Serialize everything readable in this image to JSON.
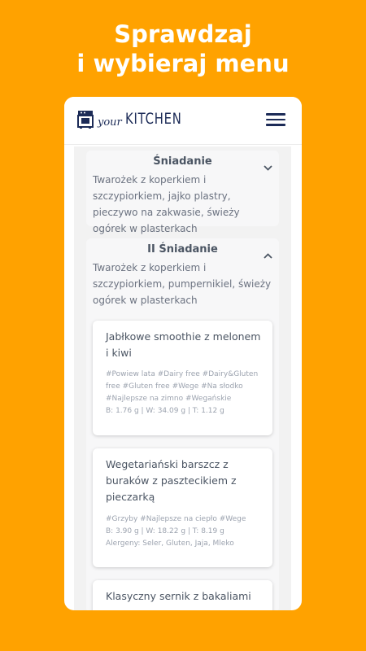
{
  "promo": {
    "line1": "Sprawdzaj",
    "line2": "i wybieraj menu"
  },
  "app": {
    "logo_your": "your",
    "logo_kitchen": "KITCHEN",
    "brand_color": "#1c2b57"
  },
  "sections": [
    {
      "title": "Śniadanie",
      "expanded": false,
      "description": "Twarożek z koperkiem i szczypiorkiem, jajko plastry, pieczywo na zakwasie, świeży ogórek w plasterkach"
    },
    {
      "title": "II Śniadanie",
      "expanded": true,
      "description": "Twarożek z koperkiem i szczypiorkiem, pumpernikiel, świeży ogórek w plasterkach"
    }
  ],
  "dishes": [
    {
      "title": "Jabłkowe smoothie z melonem i kiwi",
      "tags": "#Powiew lata #Dairy free #Dairy&Gluten free #Gluten free #Wege #Na słodko #Najlepsze na zimno #Wegańskie",
      "macros": "B: 1.76 g | W: 34.09 g | T: 1.12 g"
    },
    {
      "title": "Wegetariański barszcz z buraków z pasztecikiem z pieczarką",
      "tags": "#Grzyby #Najlepsze na ciepło #Wege",
      "macros": "B: 3.90 g | W: 18.22 g | T: 8.19 g",
      "allergens": "Alergeny: Seler, Gluten, Jaja, Mleko"
    },
    {
      "title": "Klasyczny sernik z bakaliami"
    }
  ],
  "colors": {
    "background": "#FFA200",
    "text_muted": "#6b7280"
  }
}
